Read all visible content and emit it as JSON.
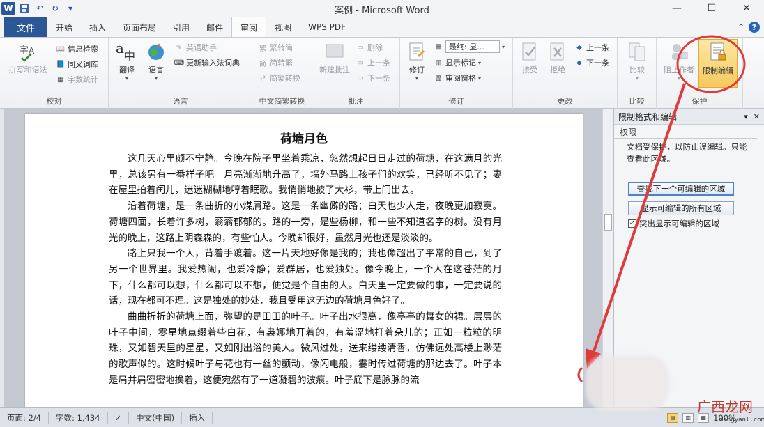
{
  "window": {
    "title": "案例 - Microsoft Word",
    "app_logo": "W",
    "minimize": "—",
    "maximize": "☐",
    "close": "✕"
  },
  "tabs": [
    {
      "label": "文件"
    },
    {
      "label": "开始"
    },
    {
      "label": "插入"
    },
    {
      "label": "页面布局"
    },
    {
      "label": "引用"
    },
    {
      "label": "邮件"
    },
    {
      "label": "审阅"
    },
    {
      "label": "视图"
    },
    {
      "label": "WPS PDF"
    }
  ],
  "active_tab": "审阅",
  "ribbon": {
    "proofing": {
      "label": "校对",
      "spell": "拼写和语法",
      "research": "信息检索",
      "thesaurus": "同义词库",
      "wordcount": "字数统计"
    },
    "language": {
      "label": "语言",
      "translate": "翻译",
      "language": "语言",
      "english_assist": "英语助手",
      "update_ime": "更新输入法词典"
    },
    "chinese_conv": {
      "label": "中文简繁转换",
      "to_simplified": "繁转简",
      "to_traditional": "简转繁",
      "conversion": "简繁转换"
    },
    "comments": {
      "label": "批注",
      "new_comment": "新建批注",
      "delete": "删除",
      "previous": "上一条",
      "next": "下一条"
    },
    "tracking": {
      "label": "修订",
      "track": "修订",
      "display_mode": "最终: 显...",
      "show_markup": "显示标记",
      "review_pane": "审阅窗格"
    },
    "changes": {
      "label": "更改",
      "accept": "接受",
      "reject": "拒绝",
      "previous": "上一条",
      "next": "下一条"
    },
    "compare": {
      "label": "比较",
      "compare": "比较"
    },
    "protect": {
      "label": "保护",
      "block_authors": "阻止作者",
      "restrict_editing": "限制编辑"
    }
  },
  "document": {
    "title": "荷塘月色",
    "paragraphs": [
      "这几天心里颇不宁静。今晚在院子里坐着乘凉，忽然想起日日走过的荷塘，在这满月的光里，总该另有一番样子吧。月亮渐渐地升高了，墙外马路上孩子们的欢笑，已经听不见了；妻在屋里拍着闰儿，迷迷糊糊地哼着眠歌。我悄悄地披了大衫，带上门出去。",
      "沿着荷塘，是一条曲折的小煤屑路。这是一条幽僻的路；白天也少人走，夜晚更加寂寞。荷塘四面，长着许多树，蓊蓊郁郁的。路的一旁，是些杨柳，和一些不知道名字的树。没有月光的晚上，这路上阴森森的，有些怕人。今晚却很好，虽然月光也还是淡淡的。",
      "路上只我一个人，背着手踱着。这一片天地好像是我的；我也像超出了平常的自己，到了另一个世界里。我爱热闹，也爱冷静；爱群居，也爱独处。像今晚上，一个人在这苍茫的月下，什么都可以想，什么都可以不想，便觉是个自由的人。白天里一定要做的事，一定要说的话，现在都可不理。这是独处的妙处，我且受用这无边的荷塘月色好了。",
      "曲曲折折的荷塘上面，弥望的是田田的叶子。叶子出水很高，像亭亭的舞女的裙。层层的叶子中间，零星地点缀着些白花，有袅娜地开着的，有羞涩地打着朵儿的；正如一粒粒的明珠，又如碧天里的星星，又如刚出浴的美人。微风过处，送来缕缕清香，仿佛远处高楼上渺茫的歌声似的。这时候叶子与花也有一丝的颤动，像闪电般，霎时传过荷塘的那边去了。叶子本是肩并肩密密地挨着，这便宛然有了一道凝碧的波痕。叶子底下是脉脉的流"
    ]
  },
  "pane": {
    "title": "限制格式和编辑",
    "section": "权限",
    "message": "文档受保护，以防止误编辑。只能查看此区域。",
    "find_next": "查找下一个可编辑的区域",
    "show_all": "显示可编辑的所有区域",
    "highlight": "突出显示可编辑的区域",
    "highlight_checked": true
  },
  "status": {
    "page": "页面: 2/4",
    "words": "字数: 1,434",
    "language": "中文(中国)",
    "insert": "插入",
    "zoom": "100%"
  },
  "watermark": {
    "text": "广西龙网",
    "url": "mingyanl.com"
  },
  "colors": {
    "accent": "#2b5797",
    "annotation": "#e03b3b"
  }
}
